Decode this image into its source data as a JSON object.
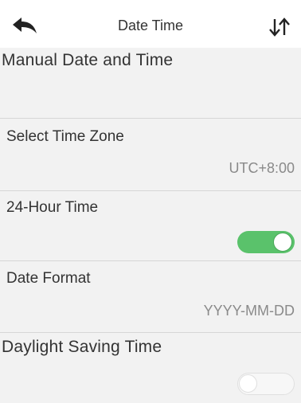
{
  "header": {
    "title": "Date Time",
    "back_icon": "back-arrow-icon",
    "sort_icon": "sort-arrows-icon"
  },
  "items": [
    {
      "label": "Manual Date and Time"
    },
    {
      "label": "Select Time Zone",
      "value": "UTC+8:00"
    },
    {
      "label": "24-Hour Time",
      "toggle": true
    },
    {
      "label": "Date Format",
      "value": "YYYY-MM-DD"
    },
    {
      "label": "Daylight Saving Time",
      "toggle": false
    }
  ],
  "colors": {
    "toggle_on": "#5ac26b",
    "toggle_off": "#f7f7f7",
    "background": "#f2f2f2",
    "header_background": "#ffffff"
  }
}
